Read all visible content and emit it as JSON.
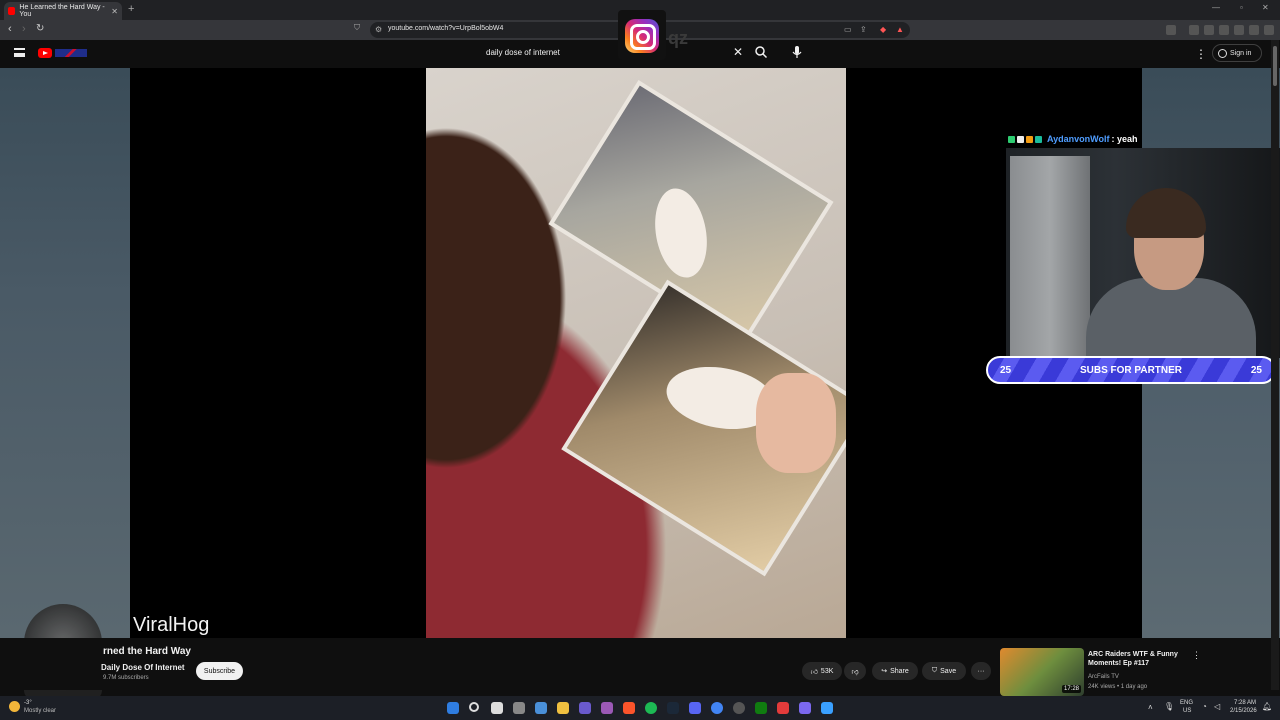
{
  "browser": {
    "tab_title": "He Learned the Hard Way - You",
    "url": "youtube.com/watch?v=UrpBol5obW4"
  },
  "youtube": {
    "search_query": "daily dose of internet",
    "sign_in": "Sign in"
  },
  "video": {
    "watermark": "ViralHog",
    "title": "rned the Hard Way",
    "channel": "Daily Dose Of Internet",
    "subscribers": "9.7M subscribers",
    "subscribe_label": "Subscribe",
    "likes": "53K",
    "share_label": "Share",
    "save_label": "Save"
  },
  "overlay": {
    "qz_text": "qz",
    "chat_user": "AydanvonWolf",
    "chat_message": ": yeah",
    "partner_left": "25",
    "partner_label": "SUBS FOR PARTNER",
    "partner_right": "25"
  },
  "related": {
    "title": "ARC Raiders WTF & Funny Moments! Ep #117",
    "channel": "ArcFails TV",
    "meta": "24K views • 1 day ago",
    "duration": "17:28"
  },
  "taskbar": {
    "weather_temp": "-3°",
    "weather_desc": "Mostly clear",
    "lang_top": "ENG",
    "lang_bottom": "US",
    "time": "7:28 AM",
    "date": "2/15/2026"
  },
  "colors": {
    "youtube_red": "#ff0000",
    "chat_user": "#4f9dff",
    "partner_bar": "#3a3ad8"
  }
}
